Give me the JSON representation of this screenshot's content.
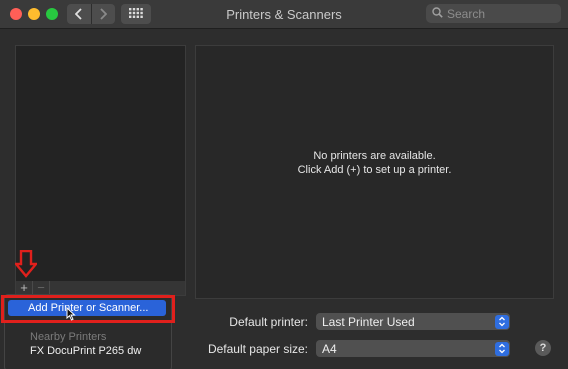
{
  "window": {
    "title": "Printers & Scanners"
  },
  "search": {
    "placeholder": "Search"
  },
  "printer_list": {
    "add_label": "+",
    "remove_label": "−"
  },
  "detail": {
    "empty_line1": "No printers are available.",
    "empty_line2": "Click Add (+) to set up a printer."
  },
  "default_printer": {
    "label": "Default printer:",
    "value": "Last Printer Used"
  },
  "default_paper": {
    "label": "Default paper size:",
    "value": "A4"
  },
  "help": {
    "label": "?"
  },
  "add_menu": {
    "selected_item": "Add Printer or Scanner...",
    "section_header": "Nearby Printers",
    "items": [
      "FX DocuPrint P265 dw"
    ]
  },
  "colors": {
    "accent": "#2a63d9",
    "highlight": "#e0201c",
    "background": "#2d2d2d"
  },
  "icons": {
    "back": "chevron-left-icon",
    "forward": "chevron-right-icon",
    "grid": "grid-icon",
    "search": "search-icon",
    "annotation_arrow": "arrow-down-icon",
    "cursor": "pointer-cursor-icon"
  }
}
